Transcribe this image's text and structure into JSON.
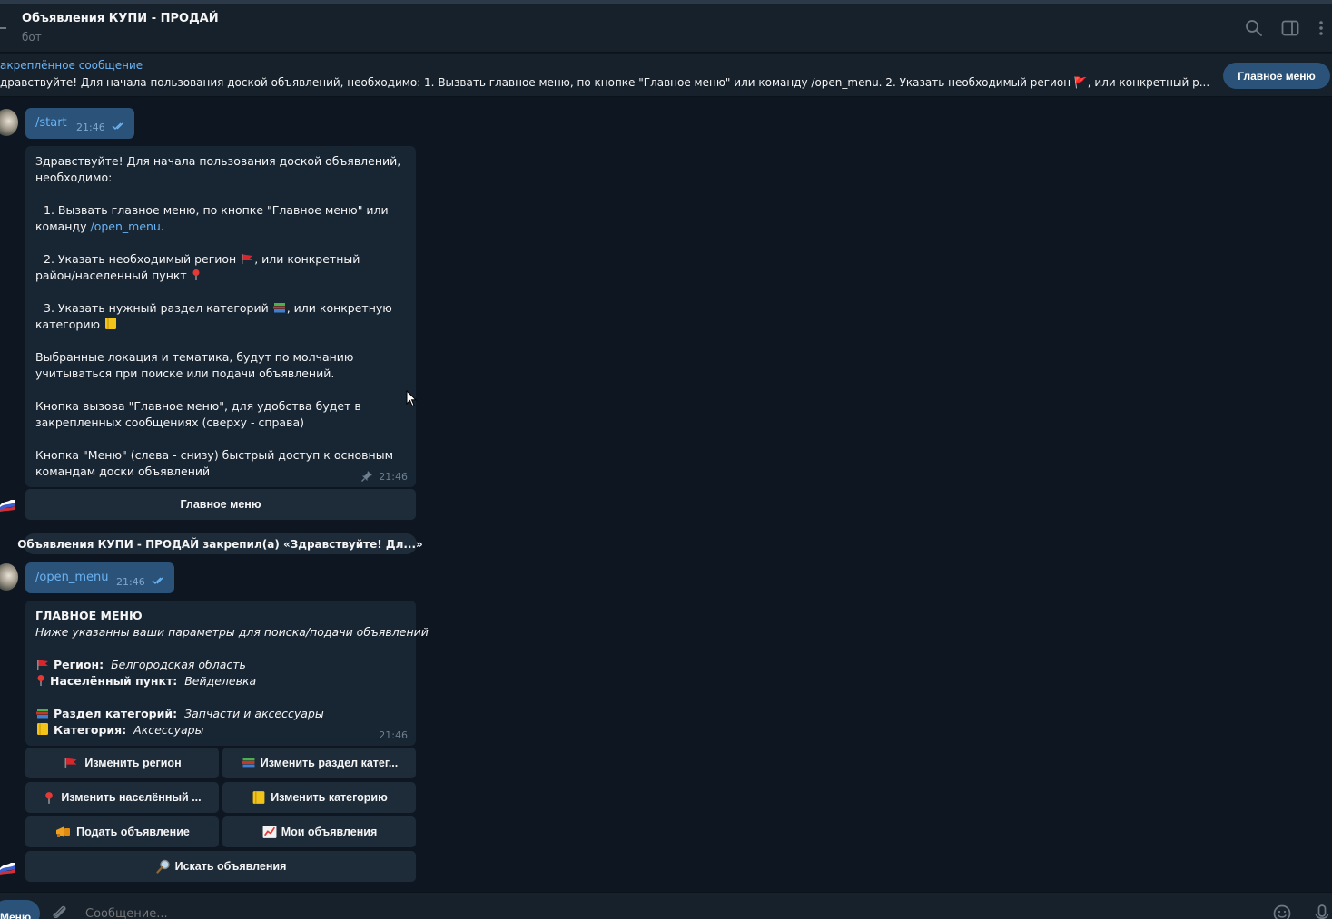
{
  "header": {
    "title": "Объявления КУПИ - ПРОДАЙ",
    "subtitle": "бот"
  },
  "pinned": {
    "label": "акреплённое сообщение",
    "text": "дравствуйте! Для начала пользования доской объявлений, необходимо:    1. Вызвать главное меню, по кнопке \"Главное меню\" или команду /open_menu.    2. Указать необходимый регион 🚩, или конкретный р...",
    "button": "Главное меню"
  },
  "messages": {
    "start_cmd": {
      "text": "/start",
      "time": "21:46"
    },
    "welcome": {
      "l1": "Здравствуйте! Для начала пользования доской объявлений,",
      "l2": "необходимо:",
      "l3": "1. Вызвать главное меню, по кнопке \"Главное меню\" или",
      "l4_prefix": "команду ",
      "l4_link": "/open_menu",
      "l4_suffix": ".",
      "l5": "2. Указать необходимый регион",
      "l5b": ", или конкретный",
      "l6": "район/населенный пункт",
      "l7": "3. Указать нужный раздел категорий",
      "l7b": ", или конкретную",
      "l8": "категорию",
      "l9": "Выбранные локация и тематика, будут по молчанию",
      "l10": "учитываться при поиске или подачи объявлений.",
      "l11": "Кнопка вызова \"Главное меню\", для удобства будет в",
      "l12": "закрепленных сообщениях (сверху - справа)",
      "l13": "Кнопка \"Меню\" (слева - снизу) быстрый доступ к основным",
      "l14": "командам доски объявлений",
      "time": "21:46",
      "button": "Главное меню"
    },
    "service": "Объявления КУПИ - ПРОДАЙ закрепил(а) «Здравствуйте! Дл...»",
    "open_menu_cmd": {
      "text": "/open_menu",
      "time": "21:46"
    },
    "main_menu": {
      "heading": "ГЛАВНОЕ МЕНЮ",
      "subheading": "Ниже указанны ваши параметры для поиска/подачи объявлений",
      "region_label": "Регион:",
      "region_value": "Белгородская область",
      "locality_label": "Населённый пункт:",
      "locality_value": "Вейделевка",
      "section_label": "Раздел категорий:",
      "section_value": "Запчасти и аксессуары",
      "category_label": "Категория:",
      "category_value": "Аксессуары",
      "time": "21:46",
      "buttons": {
        "change_region": "Изменить регион",
        "change_section": "Изменить раздел катег...",
        "change_locality": "Изменить населённый ...",
        "change_category": "Изменить категорию",
        "submit_ad": "Подать объявление",
        "my_ads": "Мои объявления",
        "search_ads": "Искать объявления"
      }
    }
  },
  "composer": {
    "menu_button": "Меню",
    "placeholder": "Сообщение..."
  },
  "colors": {
    "background": "#0e1621",
    "panel": "#17212b",
    "incoming_bubble": "#182533",
    "outgoing_bubble": "#2b5278",
    "keyboard_button": "#1e2c3a",
    "link": "#6ab3f3",
    "muted": "#6c7883"
  }
}
